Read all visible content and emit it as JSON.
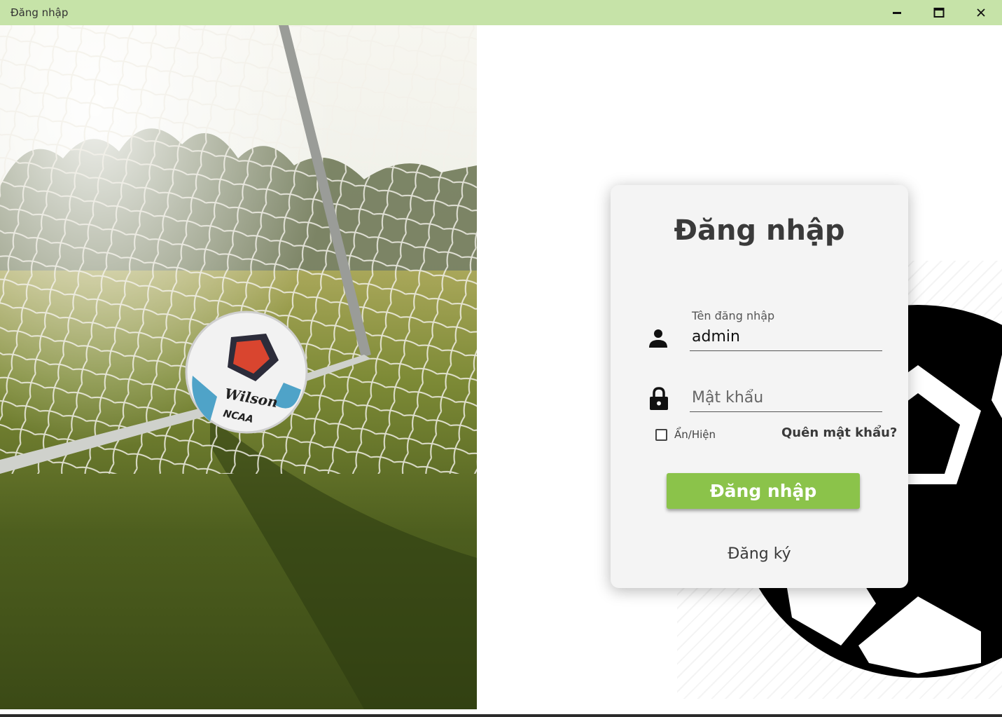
{
  "window": {
    "title": "Đăng nhập",
    "controls": [
      "minimize-icon",
      "maximize-icon",
      "close-icon"
    ]
  },
  "hero_image": {
    "description_icon": "soccer-ball-in-goal-photo"
  },
  "card": {
    "title": "Đăng nhập",
    "username": {
      "label": "Tên đăng nhập",
      "value": "admin",
      "icon": "user-icon"
    },
    "password": {
      "placeholder": "Mật khẩu",
      "value": "",
      "icon": "lock-icon"
    },
    "show_hide_label": "Ẩn/Hiện",
    "show_hide_checked": false,
    "forgot_label": "Quên mật khẩu?",
    "login_button": "Đăng nhập",
    "register_link": "Đăng ký"
  },
  "colors": {
    "titlebar": "#c6e3a8",
    "accent": "#8bc34a",
    "card": "#f4f4f4",
    "text": "#3a3a3a"
  }
}
